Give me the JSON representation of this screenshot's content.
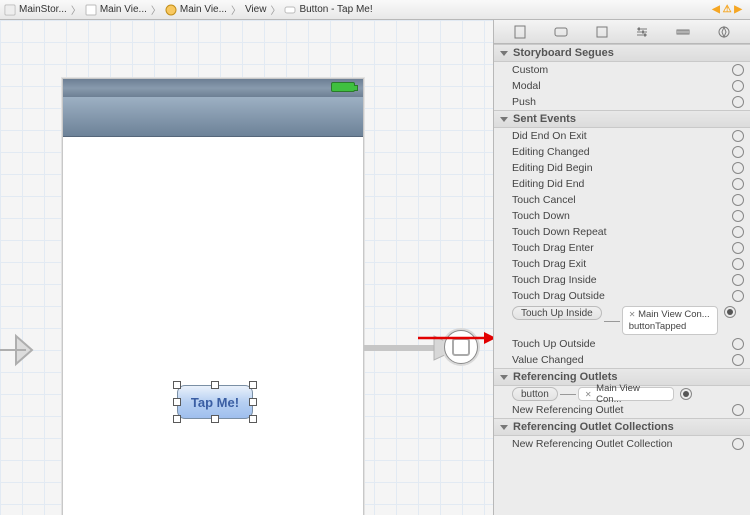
{
  "breadcrumb": {
    "items": [
      "MainStor...",
      "Main Vie...",
      "Main Vie...",
      "View",
      "Button - Tap Me!"
    ]
  },
  "device": {
    "button_label": "Tap Me!"
  },
  "inspector": {
    "sections": {
      "segues": {
        "title": "Storyboard Segues",
        "rows": [
          "Custom",
          "Modal",
          "Push"
        ]
      },
      "sent_events": {
        "title": "Sent Events",
        "rows": [
          "Did End On Exit",
          "Editing Changed",
          "Editing Did Begin",
          "Editing Did End",
          "Touch Cancel",
          "Touch Down",
          "Touch Down Repeat",
          "Touch Drag Enter",
          "Touch Drag Exit",
          "Touch Drag Inside",
          "Touch Drag Outside"
        ],
        "connected": {
          "label": "Touch Up Inside",
          "target_title": "Main View Con...",
          "target_action": "buttonTapped"
        },
        "rows_after": [
          "Touch Up Outside",
          "Value Changed"
        ]
      },
      "ref_outlets": {
        "title": "Referencing Outlets",
        "connected": {
          "label": "button",
          "target_title": "Main View Con..."
        },
        "rows": [
          "New Referencing Outlet"
        ]
      },
      "ref_outlet_coll": {
        "title": "Referencing Outlet Collections",
        "rows": [
          "New Referencing Outlet Collection"
        ]
      }
    }
  }
}
